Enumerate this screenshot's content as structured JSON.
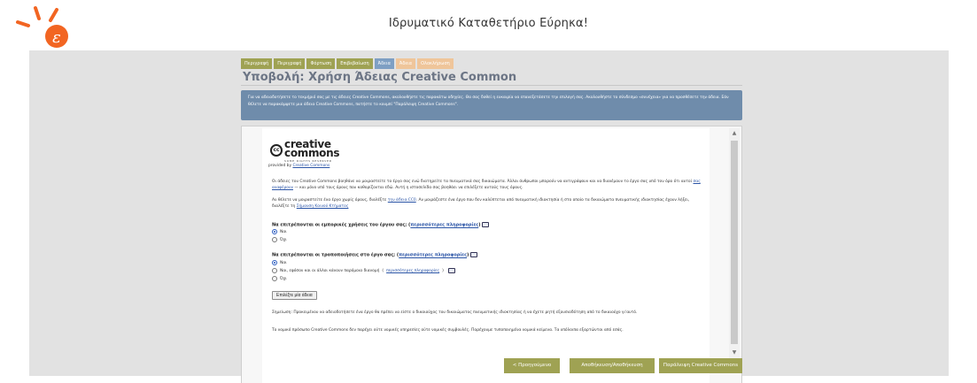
{
  "header": {
    "site_title": "Ιδρυματικό Καταθετήριο Εύρηκα!",
    "logo_icon": "eureka-logo-icon",
    "accent": "#f26522"
  },
  "progress": {
    "steps": [
      {
        "label": "Περιγραφή",
        "state": "done"
      },
      {
        "label": "Περιγραφή",
        "state": "done"
      },
      {
        "label": "Φόρτωση",
        "state": "done"
      },
      {
        "label": "Επιβεβαίωση",
        "state": "done"
      },
      {
        "label": "Άδεια",
        "state": "current"
      },
      {
        "label": "Άδεια",
        "state": "todo"
      },
      {
        "label": "Ολοκλήρωση",
        "state": "todo"
      }
    ]
  },
  "page_title": "Υποβολή: Χρήση Άδειας Creative Common",
  "info_text": "Για να αδειοδοτήσετε το τεκμήριό σας με τις άδειες Creative Commons, ακολουθήστε τις παρακάτω οδηγίες. Θα σας δοθεί η ευκαιρία να επανεξετάσετε την επιλογή σας. Ακολουθήστε το σύνδεσμο «συνέχεια» για να προσθέσετε την άδεια. Εάν θέλετε να παρακάμψετε μια άδεια Creative Commons, πατήστε το κουμπί \"Παράλειψη Creative Commons\".",
  "cc": {
    "logo_word_top": "creative",
    "logo_word_bottom": "commons",
    "logo_sub": "SOME RIGHTS RESERVED",
    "circle": "cc",
    "provided_prefix": "provided by",
    "provided_link": "Creative Commons",
    "para1_a": "Οι άδειες του Creative Commons βοηθάνε να μοιραστείτε το έργο σας ενώ διατηρείτε τα πνευματικά σας δικαιώματα. Άλλοι άνθρωποι μπορούν να αντιγράψουν και να διανέμουν το έργο σας υπό τον όρο ότι αυτοί",
    "para1_link": "σας αναφέρουν",
    "para1_b": "— και μόνο υπό τους όρους που καθορίζονται εδώ. Αυτή η ιστοσελίδα σας βοηθάει να επιλέξετε αυτούς τους όρους.",
    "para2_a": "Αν θέλετε να μοιραστείτε ένα έργο χωρίς όρους, διαλέξτε",
    "para2_link1": "την άδεια CC0",
    "para2_b": ". Αν μοιράζεστε ένα έργο που δεν καλύπτεται από πνευματική ιδιοκτησία ή στο οποίο τα δικαιώματα πνευματικής ιδιοκτησίας έχουν λήξει, διαλέξτε τη",
    "para2_link2": "Σήμανση Κοινού Κτήματος",
    "q1_text": "Να επιτρέπονται οι εμπορικές χρήσεις του έργου σας;",
    "q1_link": "περισσότερες πληροφορίες",
    "q1_options": [
      "Ναι",
      "Όχι"
    ],
    "q2_text": "Να επιτρέπονται οι τροποποιήσεις στο έργο σας;",
    "q2_link": "περισσότερες πληροφορίες",
    "q2_options": [
      "Ναι",
      "Ναι, εφόσον και οι άλλοι κάνουν παρόμοια διανομή",
      "Όχι"
    ],
    "q2_option2_link": "περισσότερες πληροφορίες",
    "choose_button": "Επιλέξτε μία άδεια",
    "note": "Σημείωση: Προκειμένου να αδειοδοτήσετε ένα έργο θα πρέπει να είστε ο δικαιούχος του δικαιώματος πνευματικής ιδιοκτησίας ή να έχετε ρητή εξουσιοδότηση από το δικαιούχο γι'αυτό.",
    "disclaimer": "Το νομικό πρόσωπο Creative Commons δεν παρέχει ούτε νομικές υπηρεσίες ούτε νομικές συμβουλές. Παρέχουμε τυποποιημένα νομικά κείμενα. Τα υπόλοιπα εξαρτώνται από εσάς."
  },
  "footer_buttons": {
    "prev": "< Προηγούμενο",
    "save": "Αποθήκευση/Αποθήκευση",
    "skip": "Παράλειψη Creative Commons"
  }
}
